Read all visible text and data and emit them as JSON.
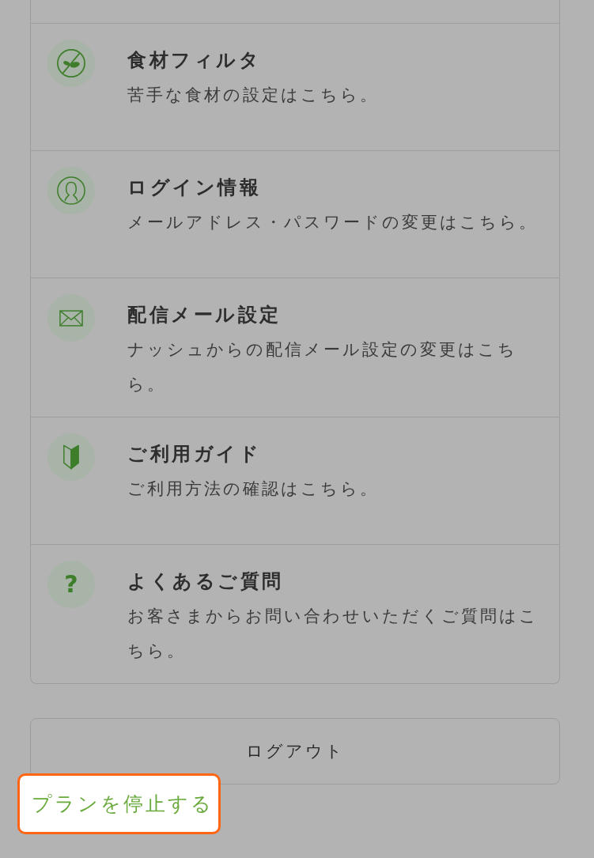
{
  "menu": {
    "items": [
      {
        "kind": "filter",
        "title": "食材フィルタ",
        "description": "苦手な食材の設定はこちら。"
      },
      {
        "kind": "account",
        "title": "ログイン情報",
        "description": "メールアドレス・パスワードの変更はこちら。"
      },
      {
        "kind": "mail",
        "title": "配信メール設定",
        "description": "ナッシュからの配信メール設定の変更はこちら。"
      },
      {
        "kind": "guide",
        "title": "ご利用ガイド",
        "description": "ご利用方法の確認はこちら。"
      },
      {
        "kind": "faq",
        "icon_text": "?",
        "title": "よくあるご質問",
        "description": "お客さまからお問い合わせいただくご質問はこちら。"
      }
    ]
  },
  "logout_button": {
    "label": "ログアウト"
  },
  "stop_plan_link": {
    "label": "プランを停止する",
    "highlighted": true
  }
}
